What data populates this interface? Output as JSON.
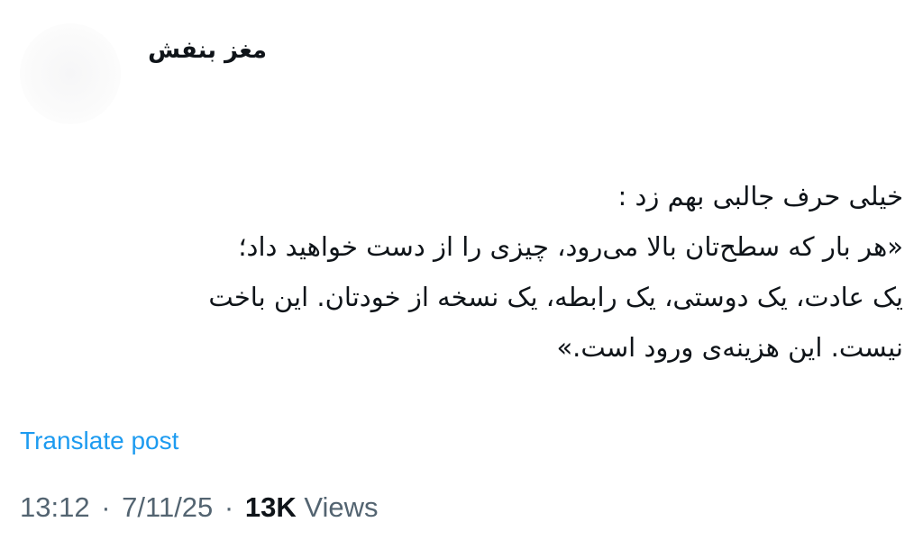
{
  "author": {
    "display_name": "مغز بنفش"
  },
  "post": {
    "lines": [
      "خیلی حرف جالبی بهم زد :",
      "«هر بار که سطح‌تان بالا می‌رود، چیزی را از دست خواهید داد؛",
      "یک عادت، یک دوستی، یک رابطه، یک نسخه از خودتان. این باخت",
      "نیست. این هزینه‌ی ورود است.»"
    ]
  },
  "translate": {
    "label": "Translate post"
  },
  "meta": {
    "time": "13:12",
    "date": "7/11/25",
    "views_count": "13K",
    "views_label": "Views",
    "separator": "·"
  },
  "colors": {
    "link": "#1d9bf0",
    "secondary_text": "#536471",
    "primary_text": "#0f1419"
  }
}
